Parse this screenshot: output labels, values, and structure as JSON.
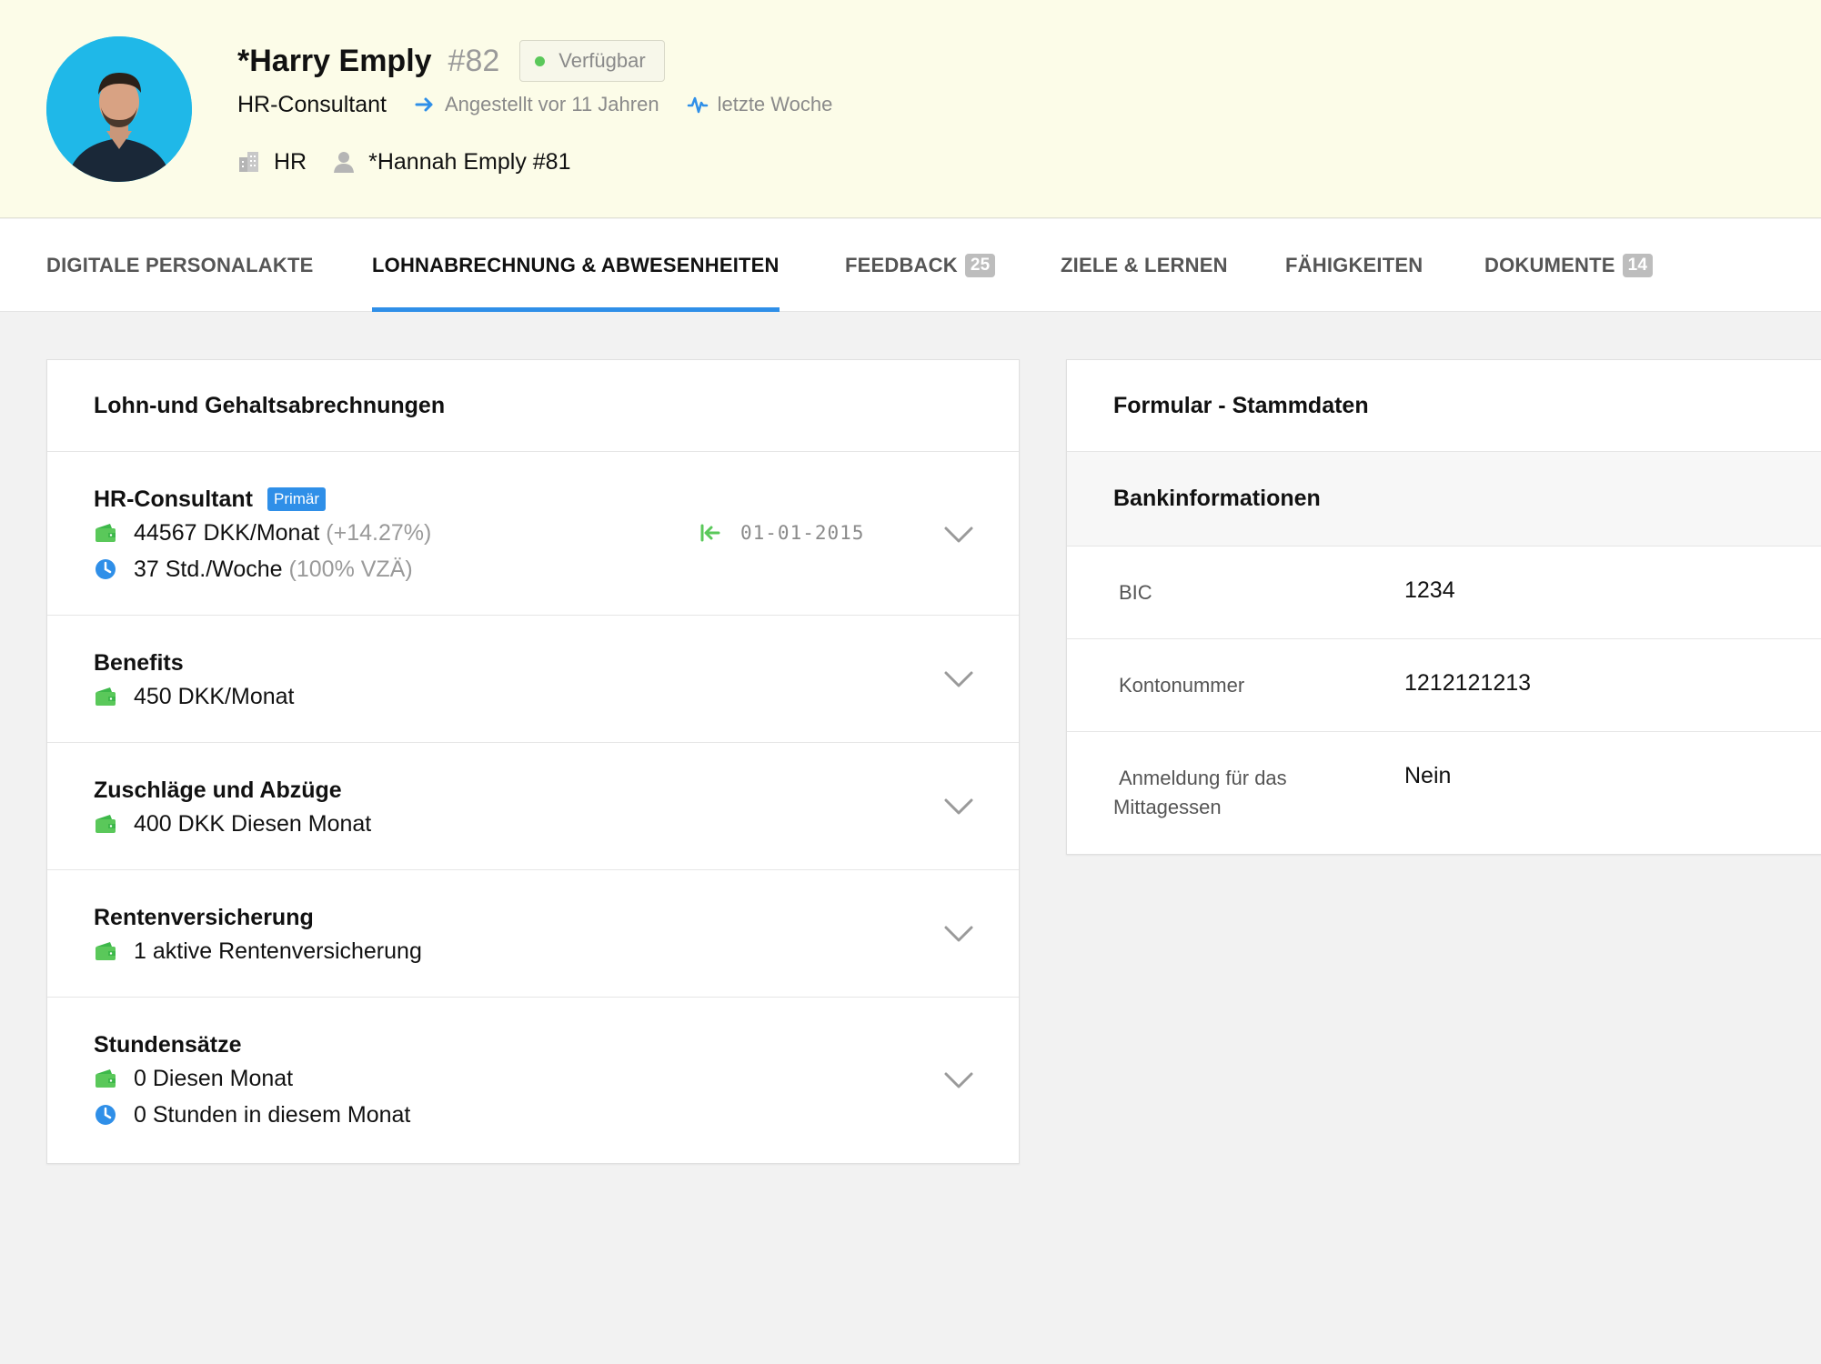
{
  "employee": {
    "name": "*Harry Emply",
    "id": "#82",
    "status": "Verfügbar",
    "status_color": "#5ac85a",
    "job_title": "HR-Consultant",
    "employed": "Angestellt vor 11 Jahren",
    "activity": "letzte Woche",
    "department": "HR",
    "manager": "*Hannah Emply #81"
  },
  "tabs": [
    {
      "label": "DIGITALE PERSONALAKTE",
      "count": ""
    },
    {
      "label": "LOHNABRECHNUNG & ABWESENHEITEN",
      "count": ""
    },
    {
      "label": "FEEDBACK",
      "count": "25"
    },
    {
      "label": "ZIELE & LERNEN",
      "count": ""
    },
    {
      "label": "FÄHIGKEITEN",
      "count": ""
    },
    {
      "label": "DOKUMENTE",
      "count": "14"
    }
  ],
  "active_tab": "LOHNABRECHNUNG & ABWESENHEITEN",
  "payroll": {
    "title": "Lohn-und Gehaltsabrechnungen",
    "position": {
      "title": "HR-Consultant",
      "tag": "Primär",
      "salary": "44567 DKK/Monat",
      "salary_change": "(+14.27%)",
      "hours": "37 Std./Woche",
      "hours_fte": "(100% VZÄ)",
      "start_date": "01-01-2015"
    },
    "benefits": {
      "title": "Benefits",
      "value": "450 DKK/Monat"
    },
    "supplements": {
      "title": "Zuschläge und Abzüge",
      "value": "400 DKK Diesen Monat"
    },
    "pension": {
      "title": "Rentenversicherung",
      "value": "1 aktive Rentenversicherung"
    },
    "hourly": {
      "title": "Stundensätze",
      "value": "0 Diesen Monat",
      "hours": "0 Stunden in diesem Monat"
    }
  },
  "master_data": {
    "title": "Formular - Stammdaten",
    "section": "Bankinformationen",
    "fields": [
      {
        "label": "BIC",
        "value": "1234"
      },
      {
        "label": "Kontonummer",
        "value": "1212121213"
      },
      {
        "label": "Anmeldung für das Mittagessen",
        "value": "Nein"
      }
    ]
  },
  "colors": {
    "accent": "#2f8fe8",
    "money_icon": "#5ac85a",
    "header_bg": "#fcfce8"
  },
  "icons": [
    "wallet-icon",
    "clock-icon",
    "chevron-down-icon",
    "arrow-right-icon",
    "activity-icon",
    "building-icon",
    "person-icon",
    "start-date-icon"
  ]
}
